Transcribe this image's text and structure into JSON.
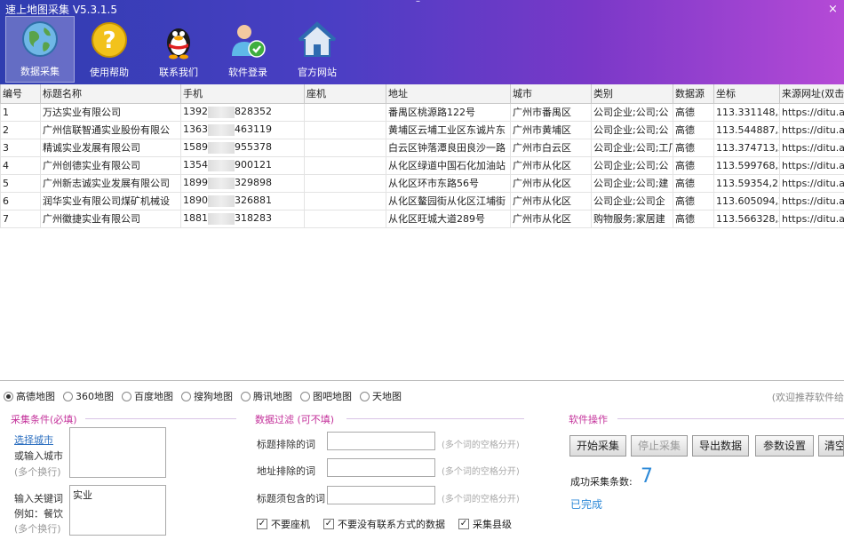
{
  "app": {
    "title": "速上地图采集 V5.3.1.5"
  },
  "window_controls": {
    "minimize": "–",
    "close": "×"
  },
  "toolbar": [
    {
      "label": "数据采集",
      "icon": "globe-icon"
    },
    {
      "label": "使用帮助",
      "icon": "help-icon"
    },
    {
      "label": "联系我们",
      "icon": "qq-penguin-icon"
    },
    {
      "label": "软件登录",
      "icon": "user-login-icon"
    },
    {
      "label": "官方网站",
      "icon": "home-icon"
    }
  ],
  "table": {
    "headers": [
      "编号",
      "标题名称",
      "手机",
      "座机",
      "地址",
      "城市",
      "类别",
      "数据源",
      "坐标",
      "来源网址(双击"
    ],
    "rows": [
      [
        "1",
        "万达实业有限公司",
        "1392",
        "828352",
        "",
        "番禺区桃源路122号",
        "广州市番禺区",
        "公司企业;公司;公",
        "高德",
        "113.331148,22",
        "https://ditu.ama"
      ],
      [
        "2",
        "广州信联智通实业股份有限公",
        "1363",
        "463119",
        "",
        "黄埔区云埔工业区东诚片东",
        "广州市黄埔区",
        "公司企业;公司;公",
        "高德",
        "113.544887,23",
        "https://ditu.ama"
      ],
      [
        "3",
        "精诚实业发展有限公司",
        "1589",
        "955378",
        "",
        "白云区钟落潭良田良沙一路",
        "广州市白云区",
        "公司企业;公司;工厂;工",
        "高德",
        "113.374713,23",
        "https://ditu.ama"
      ],
      [
        "4",
        "广州创德实业有限公司",
        "1354",
        "900121",
        "",
        "从化区绿道中国石化加油站",
        "广州市从化区",
        "公司企业;公司;公",
        "高德",
        "113.599768,23",
        "https://ditu.ama"
      ],
      [
        "5",
        "广州新志诚实业发展有限公司",
        "1899",
        "329898",
        "",
        "从化区环市东路56号",
        "广州市从化区",
        "公司企业;公司;建",
        "高德",
        "113.59354,23.",
        "https://ditu.ama"
      ],
      [
        "6",
        "润华实业有限公司煤矿机械设",
        "1890",
        "326881",
        "",
        "从化区鳌园街从化区江埔街",
        "广州市从化区",
        "公司企业;公司企",
        "高德",
        "113.605094,23",
        "https://ditu.ama"
      ],
      [
        "7",
        "广州徽捷实业有限公司",
        "1881",
        "318283",
        "",
        "从化区旺城大道289号",
        "广州市从化区",
        "购物服务;家居建",
        "高德",
        "113.566328,23",
        "https://ditu.ama"
      ]
    ]
  },
  "map_sources": {
    "options": [
      "高德地图",
      "360地图",
      "百度地图",
      "搜狗地图",
      "腾讯地图",
      "图吧地图",
      "天地图"
    ],
    "selected": "高德地图"
  },
  "welcome_text": "(欢迎推荐软件给",
  "collect_conditions": {
    "title": "采集条件(必填)",
    "select_city_link": "选择城市",
    "or_input_city": "或输入城市",
    "multi_line_hint": "(多个换行)",
    "keyword_label": "输入关键词",
    "keyword_example": "例如：餐饮",
    "keyword_hint": "(多个换行)",
    "keyword_value": "实业",
    "city_value": ""
  },
  "data_filter": {
    "title": "数据过滤 (可不填)",
    "title_exclude_label": "标题排除的词",
    "address_exclude_label": "地址排除的词",
    "title_include_label": "标题须包含的词",
    "space_hint": "(多个词的空格分开)",
    "checkbox_no_landline": "不要座机",
    "checkbox_no_contact": "不要没有联系方式的数据",
    "checkbox_county": "采集县级"
  },
  "operations": {
    "title": "软件操作",
    "start": "开始采集",
    "stop": "停止采集",
    "export": "导出数据",
    "settings": "参数设置",
    "clear": "清空",
    "success_label": "成功采集条数:",
    "success_count": "7",
    "status": "已完成"
  }
}
